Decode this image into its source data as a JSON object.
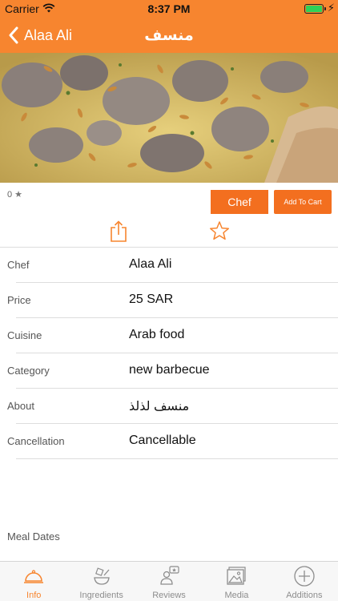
{
  "status_bar": {
    "carrier": "Carrier",
    "time": "8:37 PM",
    "battery_level": 1.0
  },
  "nav": {
    "back_label": "Alaa Ali",
    "title": "منسف"
  },
  "dish": {
    "rating_value": "0",
    "chef_button": "Chef",
    "add_to_cart_button": "Add To Cart"
  },
  "details": [
    {
      "key": "Chef",
      "value": "Alaa Ali"
    },
    {
      "key": "Price",
      "value": "25 SAR"
    },
    {
      "key": "Cuisine",
      "value": "Arab food"
    },
    {
      "key": "Category",
      "value": "new barbecue"
    },
    {
      "key": "About",
      "value": "منسف لذلذ"
    },
    {
      "key": "Cancellation",
      "value": "Cancellable"
    }
  ],
  "meal_dates_label": "Meal Dates",
  "tabs": [
    {
      "label": "Info",
      "icon": "cloche-icon",
      "active": true
    },
    {
      "label": "Ingredients",
      "icon": "ingredients-icon",
      "active": false
    },
    {
      "label": "Reviews",
      "icon": "reviews-icon",
      "active": false
    },
    {
      "label": "Media",
      "icon": "media-icon",
      "active": false
    },
    {
      "label": "Additions",
      "icon": "add-circle-icon",
      "active": false
    }
  ],
  "colors": {
    "brand": "#f7852f",
    "button": "#f36f1f",
    "battery": "#2fd158"
  }
}
